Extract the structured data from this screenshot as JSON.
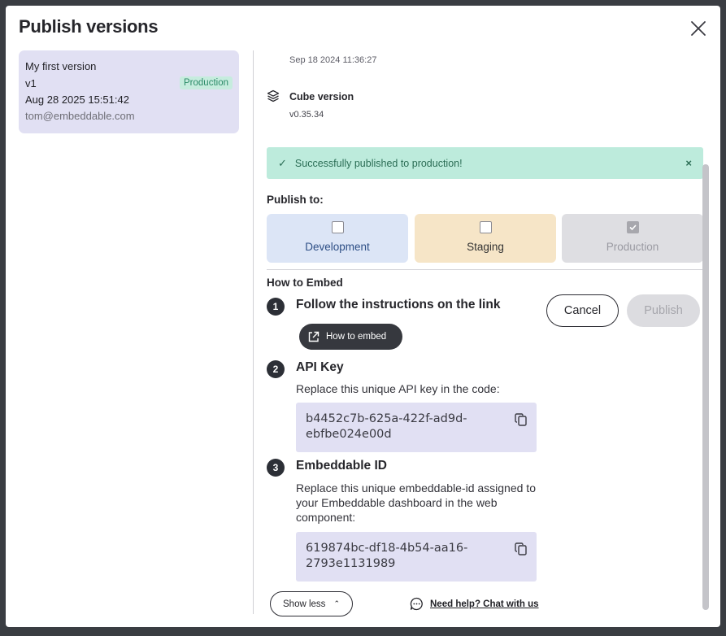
{
  "modal": {
    "title": "Publish versions"
  },
  "versions": [
    {
      "name": "My first version",
      "tag": "v1",
      "badge": "Production",
      "date": "Aug 28 2025 15:51:42",
      "author": "tom@embeddable.com"
    }
  ],
  "details": {
    "timestamp": "Sep 18 2024 11:36:27",
    "cube_label": "Cube version",
    "cube_value": "v0.35.34"
  },
  "success": {
    "message": "Successfully published to production!",
    "close": "×"
  },
  "publish": {
    "label": "Publish to:",
    "environments": [
      {
        "name": "Development",
        "checked": false,
        "disabled": false
      },
      {
        "name": "Staging",
        "checked": false,
        "disabled": false
      },
      {
        "name": "Production",
        "checked": true,
        "disabled": true
      }
    ],
    "cancel": "Cancel",
    "submit": "Publish"
  },
  "embed": {
    "heading": "How to Embed",
    "steps": [
      {
        "num": "1",
        "title": "Follow the instructions on the link",
        "button": "How to embed"
      },
      {
        "num": "2",
        "title": "API Key",
        "desc": "Replace this unique API key in the code:",
        "code": "b4452c7b-625a-422f-ad9d-ebfbe024e00d"
      },
      {
        "num": "3",
        "title": "Embeddable ID",
        "desc": "Replace this unique embeddable-id assigned to your Embeddable dashboard in the web component:",
        "code": "619874bc-df18-4b54-aa16-2793e1131989"
      }
    ],
    "show_less": "Show less",
    "help": "Need help? Chat with us"
  },
  "colors": {
    "success_bg": "#bdebdc",
    "dev_bg": "#dce5f6",
    "staging_bg": "#f6e5c7",
    "card_bg": "#e1e0f3"
  }
}
